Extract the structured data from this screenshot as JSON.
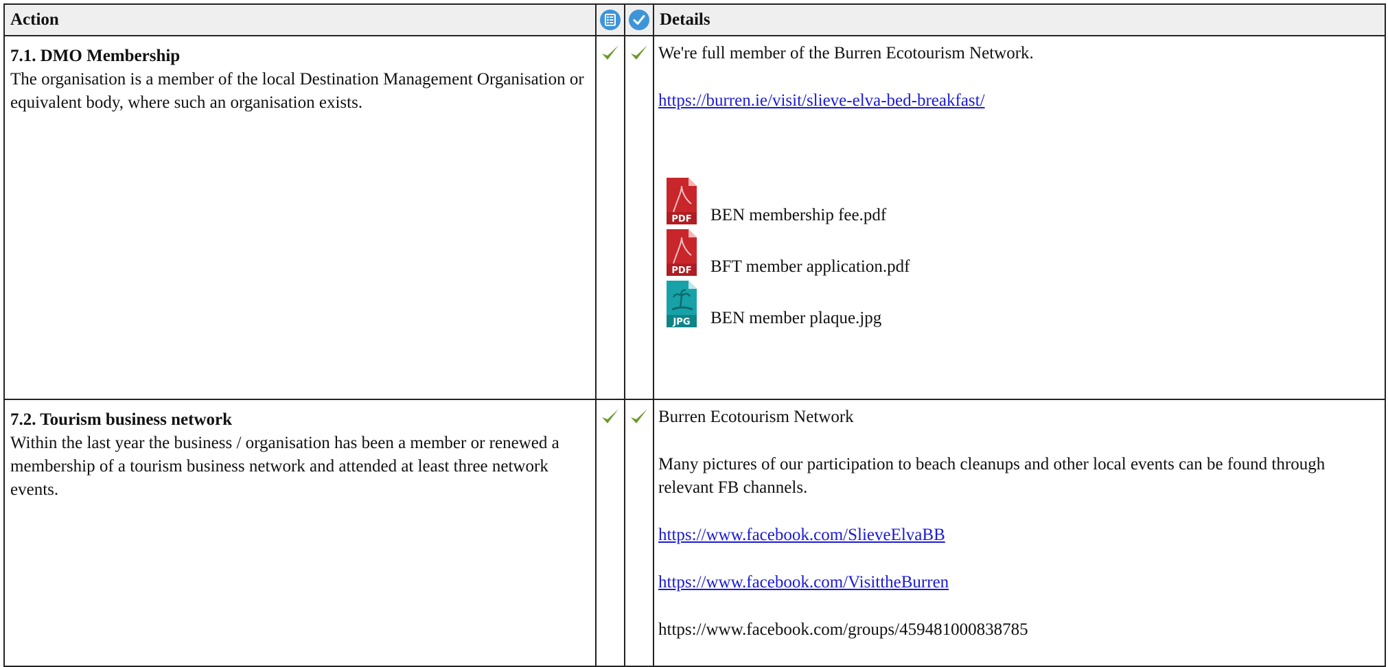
{
  "table": {
    "headers": {
      "action": "Action",
      "details": "Details",
      "icon1": "list-icon",
      "icon2": "check-circle-icon"
    },
    "rows": [
      {
        "title": "7.1. DMO Membership",
        "description": "The organisation is a member of the local Destination Management Organisation or equivalent body, where such an organisation exists.",
        "check1": "checkmark-icon",
        "check2": "checkmark-icon",
        "details": {
          "text1": "We're full member of the Burren Ecotourism Network.",
          "link1": "https://burren.ie/visit/slieve-elva-bed-breakfast/",
          "attachments": [
            {
              "name": "BEN membership fee.pdf",
              "type": "PDF",
              "icon": "pdf-file-icon"
            },
            {
              "name": "BFT member application.pdf",
              "type": "PDF",
              "icon": "pdf-file-icon"
            },
            {
              "name": "BEN member plaque.jpg",
              "type": "JPG",
              "icon": "jpg-file-icon"
            }
          ]
        }
      },
      {
        "title": "7.2. Tourism business network",
        "description": "Within the last year the business / organisation has been a member or renewed a membership of a tourism business network and attended at least three network events.",
        "check1": "checkmark-icon",
        "check2": "checkmark-icon",
        "details": {
          "text1": "Burren Ecotourism Network",
          "text2": "Many pictures of our participation to beach cleanups and other local events can be found through relevant FB channels.",
          "link1": "https://www.facebook.com/SlieveElvaBB",
          "link2": "https://www.facebook.com/VisittheBurren",
          "text3": "https://www.facebook.com/groups/459481000838785"
        }
      }
    ]
  },
  "colors": {
    "header_bg": "#efefef",
    "border": "#222222",
    "link": "#1a1ad6",
    "check_green": "#6a9a2a",
    "icon_blue": "#3d95d8",
    "pdf_red": "#c8262b",
    "jpg_teal": "#17a2a7"
  }
}
